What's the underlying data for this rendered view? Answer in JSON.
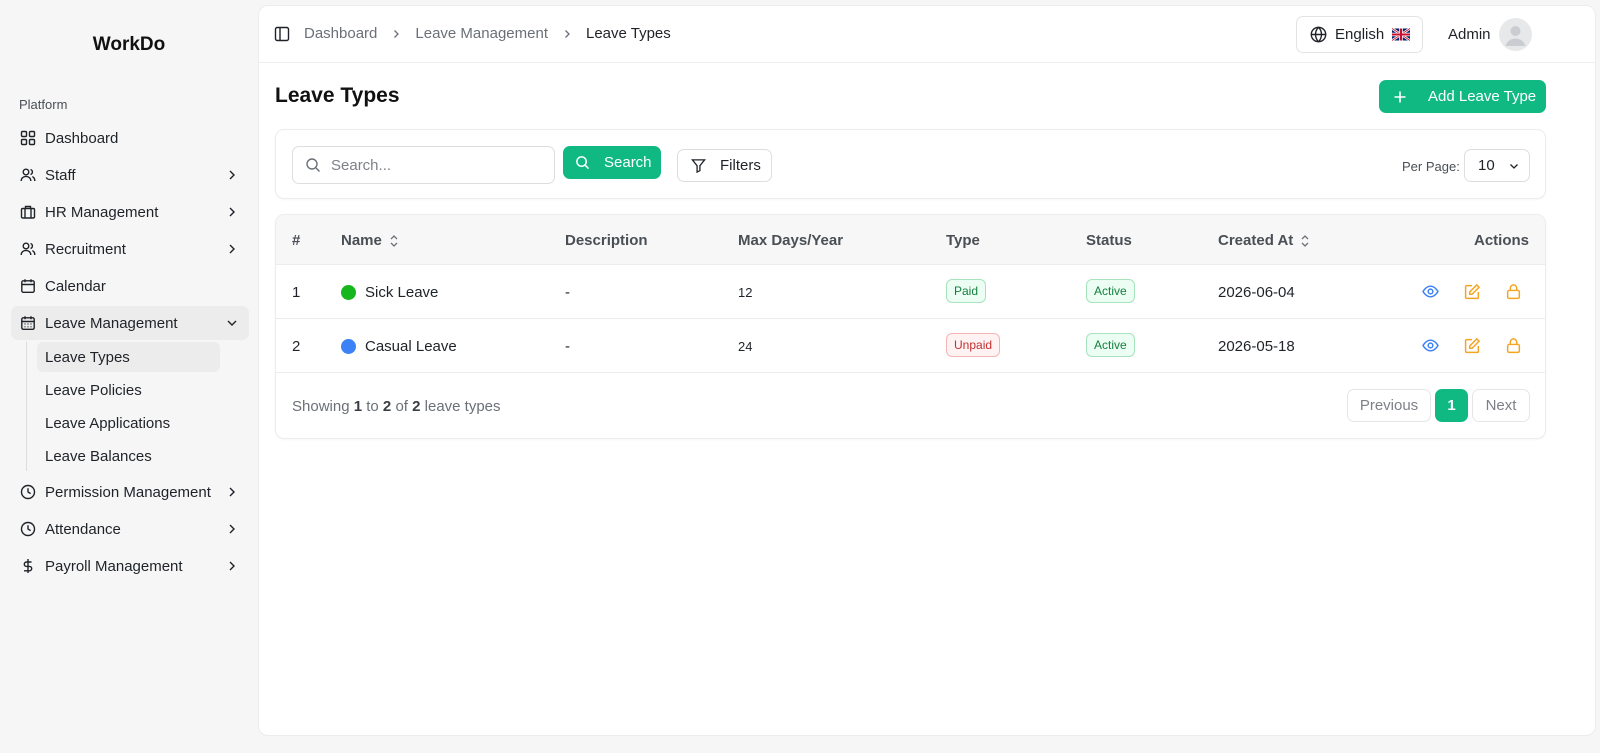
{
  "brand": "WorkDo",
  "sidebar": {
    "group_label": "Platform",
    "items": [
      {
        "label": "Dashboard",
        "icon": "grid-icon",
        "has_children": false
      },
      {
        "label": "Staff",
        "icon": "users-icon",
        "has_children": true
      },
      {
        "label": "HR Management",
        "icon": "briefcase-icon",
        "has_children": true
      },
      {
        "label": "Recruitment",
        "icon": "user-plus-icon",
        "has_children": true
      },
      {
        "label": "Calendar",
        "icon": "calendar-icon",
        "has_children": false
      },
      {
        "label": "Leave Management",
        "icon": "calendar-days-icon",
        "has_children": true,
        "expanded": true
      },
      {
        "label": "Permission Management",
        "icon": "clock-icon",
        "has_children": true
      },
      {
        "label": "Attendance",
        "icon": "clock-icon",
        "has_children": true
      },
      {
        "label": "Payroll Management",
        "icon": "dollar-icon",
        "has_children": true
      }
    ],
    "leave_subitems": [
      {
        "label": "Leave Types",
        "active": true
      },
      {
        "label": "Leave Policies",
        "active": false
      },
      {
        "label": "Leave Applications",
        "active": false
      },
      {
        "label": "Leave Balances",
        "active": false
      }
    ]
  },
  "topbar": {
    "breadcrumb": [
      "Dashboard",
      "Leave Management",
      "Leave Types"
    ],
    "language": "English",
    "user": "Admin"
  },
  "page": {
    "title": "Leave Types",
    "add_button": "Add Leave Type"
  },
  "search": {
    "placeholder": "Search...",
    "value": "",
    "search_button": "Search",
    "filters_button": "Filters",
    "per_page_label": "Per Page:",
    "per_page_value": "10"
  },
  "table": {
    "columns": [
      "#",
      "Name",
      "Description",
      "Max Days/Year",
      "Type",
      "Status",
      "Created At",
      "Actions"
    ],
    "rows": [
      {
        "index": "1",
        "name": "Sick Leave",
        "color": "#16b71d",
        "description": "-",
        "max_days": "12",
        "type": "Paid",
        "status": "Active",
        "created_at": "2026-06-04"
      },
      {
        "index": "2",
        "name": "Casual Leave",
        "color": "#3b82f6",
        "description": "-",
        "max_days": "24",
        "type": "Unpaid",
        "status": "Active",
        "created_at": "2026-05-18"
      }
    ]
  },
  "pagination": {
    "showing_prefix": "Showing",
    "from": "1",
    "to_word": "to",
    "to": "2",
    "of_word": "of",
    "total": "2",
    "suffix": "leave types",
    "previous": "Previous",
    "current": "1",
    "next": "Next"
  },
  "colors": {
    "accent": "#10b981",
    "view_icon": "#3b82f6",
    "edit_icon": "#f5a524",
    "lock_icon": "#f5a524"
  }
}
